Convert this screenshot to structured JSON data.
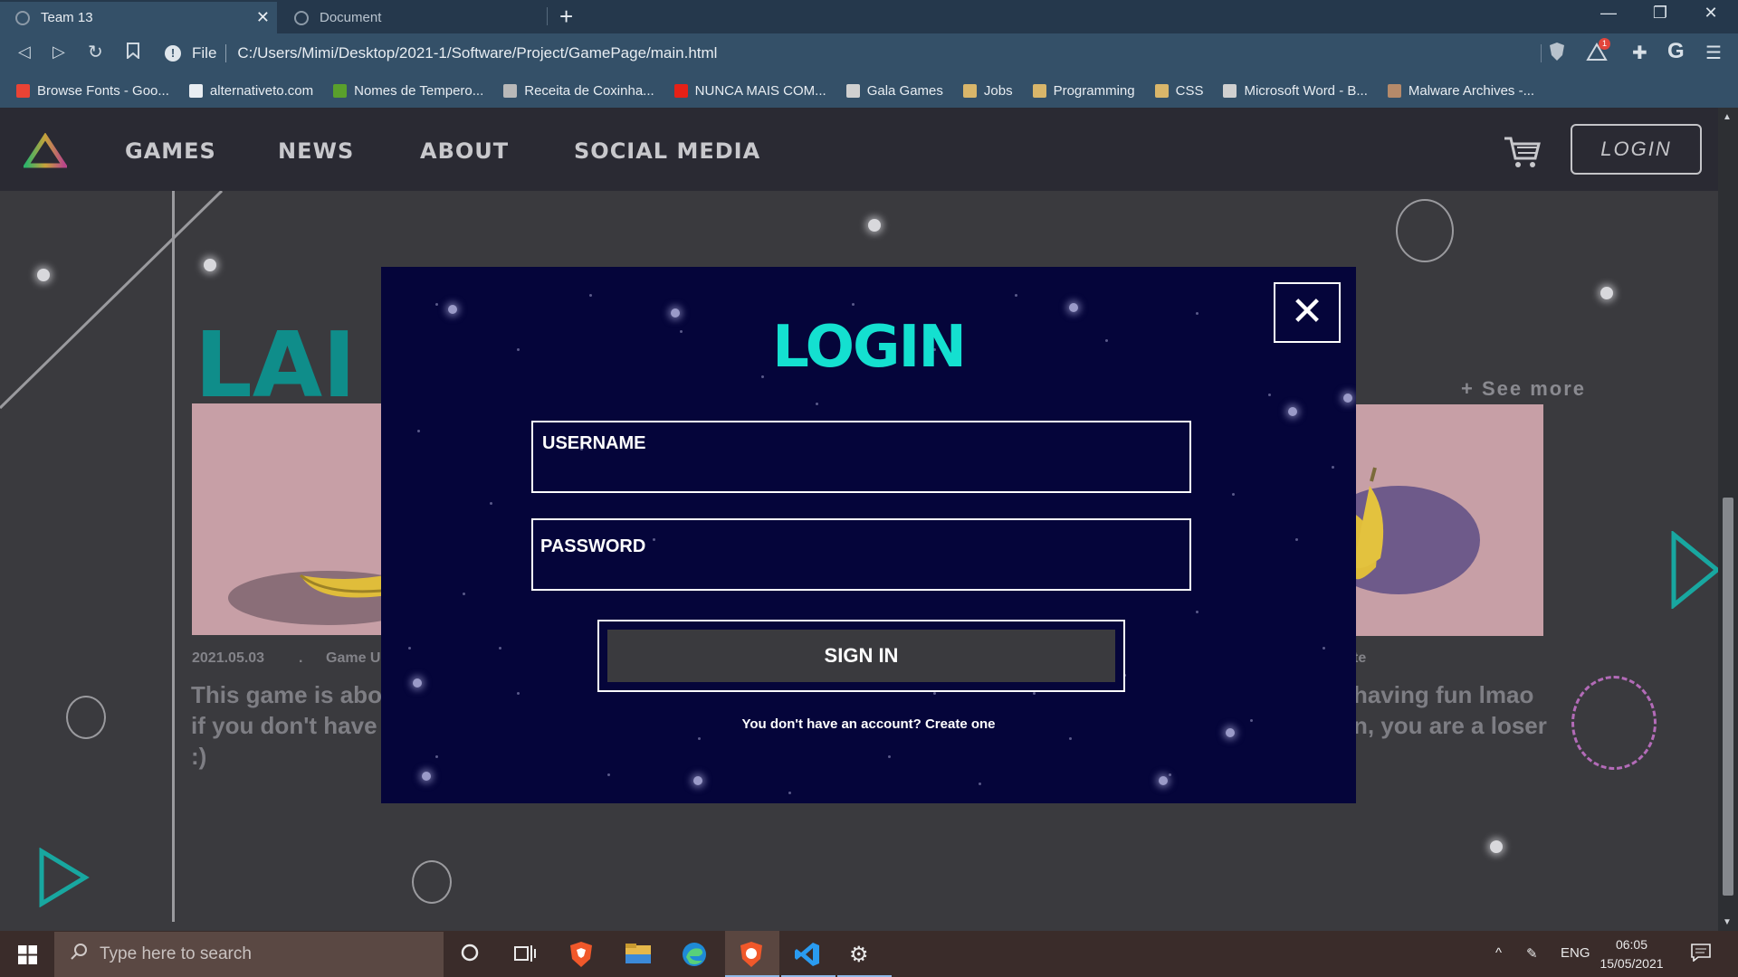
{
  "browser": {
    "tabs": [
      {
        "label": "Team 13",
        "active": true
      },
      {
        "label": "Document",
        "active": false
      }
    ],
    "address": {
      "scheme_label": "File",
      "url": "C:/Users/Mimi/Desktop/2021-1/Software/Project/GamePage/main.html"
    },
    "extension_badge": "1",
    "bookmarks": [
      {
        "label": "Browse Fonts - Goo...",
        "icon": "google-fonts-icon",
        "color": "#ea4335"
      },
      {
        "label": "alternativeto.com",
        "icon": "alternativeto-icon",
        "color": "#e8edf2"
      },
      {
        "label": "Nomes de Tempero...",
        "icon": "arrow-bookmark-icon",
        "color": "#5aa02c"
      },
      {
        "label": "Receita de Coxinha...",
        "icon": "recipe-icon",
        "color": "#b9b9b9"
      },
      {
        "label": "NUNCA MAIS COM...",
        "icon": "youtube-icon",
        "color": "#e62117"
      },
      {
        "label": "Gala Games",
        "icon": "gala-icon",
        "color": "#d0d0d0"
      },
      {
        "label": "Jobs",
        "icon": "folder-icon",
        "color": "#d9b66a"
      },
      {
        "label": "Programming",
        "icon": "folder-icon",
        "color": "#d9b66a"
      },
      {
        "label": "CSS",
        "icon": "folder-icon",
        "color": "#d9b66a"
      },
      {
        "label": "Microsoft Word - B...",
        "icon": "globe-icon",
        "color": "#d0d0d0"
      },
      {
        "label": "Malware Archives -...",
        "icon": "malware-icon",
        "color": "#b58a6a"
      }
    ]
  },
  "site": {
    "nav": [
      "GAMES",
      "NEWS",
      "ABOUT",
      "SOCIAL MEDIA"
    ],
    "login_label": "LOGIN",
    "see_more": "+ See more",
    "hero_text": "LAI",
    "card_left": {
      "date": "2021.05.03",
      "dot": ".",
      "category": "Game U",
      "desc_lines": [
        "This game is abo",
        "if you don't have",
        ":)"
      ]
    },
    "card_right": {
      "category": "te",
      "desc_lines": [
        "having fun lmao",
        "n, you are a loser"
      ]
    }
  },
  "modal": {
    "title": "LOGIN",
    "username_label": "USERNAME",
    "password_label": "PASSWORD",
    "submit_label": "SIGN IN",
    "create_text": "You don't have an account? Create one"
  },
  "taskbar": {
    "search_placeholder": "Type here to search",
    "language": "ENG",
    "time": "06:05",
    "date": "15/05/2021"
  },
  "colors": {
    "accent": "#14e0d0",
    "modal_bg": "#05053a",
    "page_bg": "#3a3a3e",
    "browser_bar": "#345068"
  }
}
